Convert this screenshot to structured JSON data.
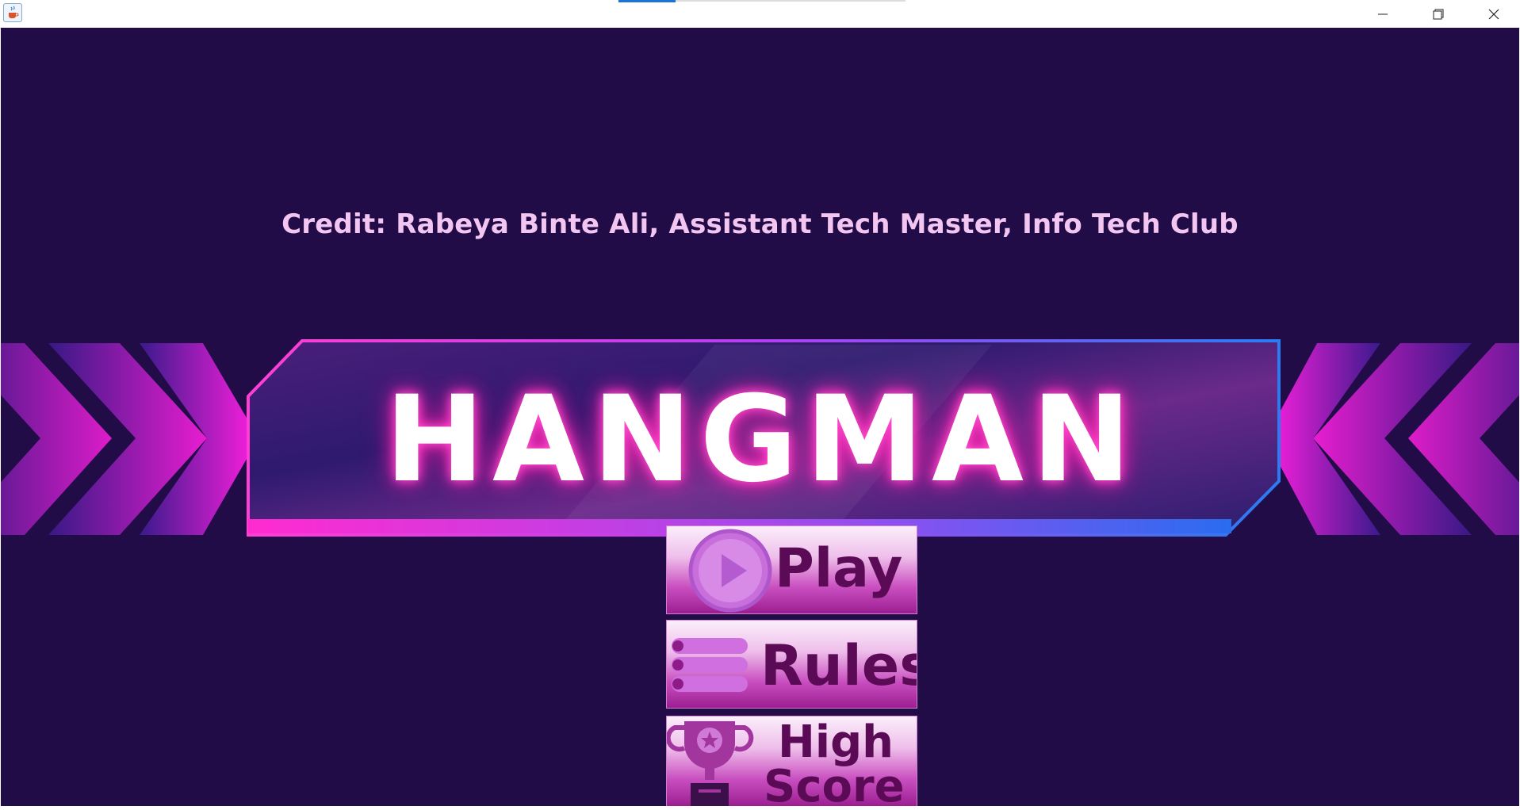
{
  "window": {
    "title_text": "",
    "controls": {
      "minimize_icon": "minimize-icon",
      "maximize_icon": "restore-icon",
      "close_icon": "close-icon"
    }
  },
  "game": {
    "credit": "Credit: Rabeya Binte Ali, Assistant Tech Master, Info Tech Club",
    "logo_title": "HANGMAN",
    "menu": {
      "play_label": "Play",
      "rules_label": "Rules",
      "highscore_line1": "High",
      "highscore_line2": "Score"
    }
  },
  "colors": {
    "background": "#220c47",
    "credit_text": "#f3c6f1",
    "accent_magenta": "#e21ad4",
    "accent_blue": "#2a78e8",
    "button_text": "#5b0b55"
  }
}
